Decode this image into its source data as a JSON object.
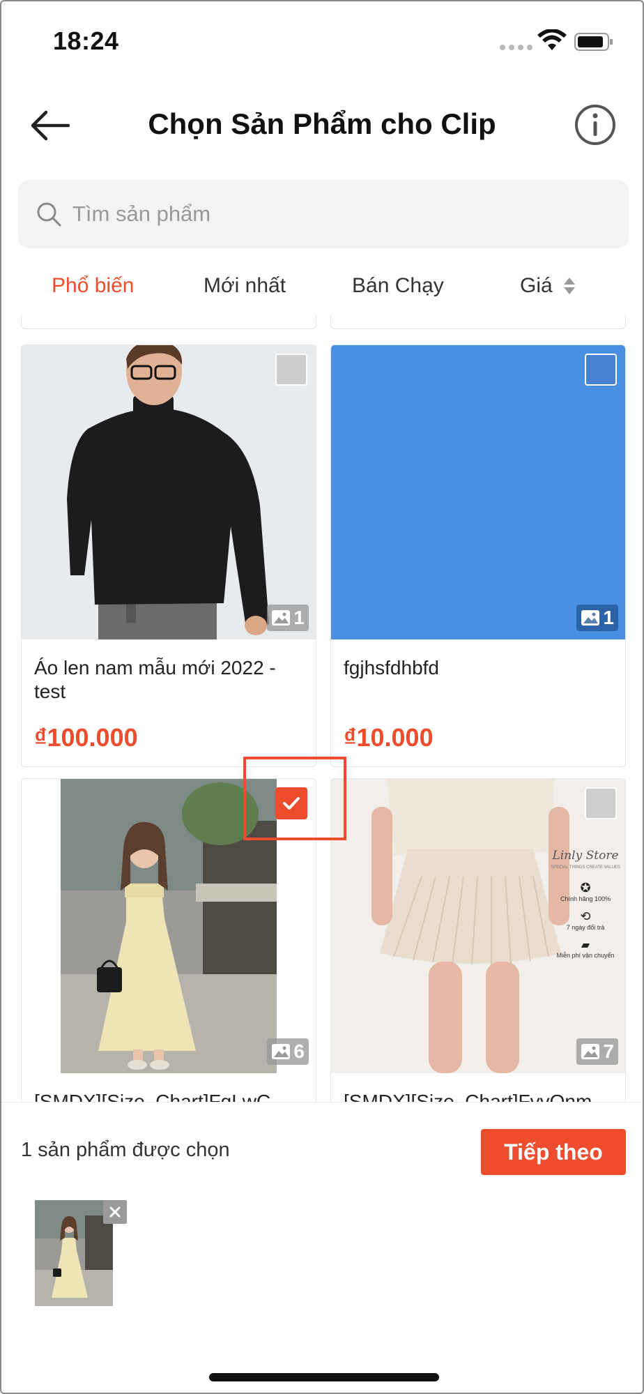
{
  "status_bar": {
    "time": "18:24"
  },
  "header": {
    "title": "Chọn Sản Phẩm cho Clip"
  },
  "search": {
    "placeholder": "Tìm sản phẩm"
  },
  "tabs": [
    {
      "label": "Phổ biến",
      "active": true
    },
    {
      "label": "Mới nhất",
      "active": false
    },
    {
      "label": "Bán Chạy",
      "active": false
    },
    {
      "label": "Giá",
      "active": false
    }
  ],
  "products": [
    {
      "name": "Áo len nam mẫu mới 2022 - test",
      "price": "₫100.000",
      "image_count": "1",
      "selected": false
    },
    {
      "name": "fgjhsfdhbfd",
      "price": "₫10.000",
      "image_count": "1",
      "selected": false
    },
    {
      "name": "[SMDX][Size_Chart]FqLwC",
      "price": "",
      "image_count": "6",
      "selected": true
    },
    {
      "name": "[SMDX][Size_Chart]FvvQnm",
      "price": "",
      "image_count": "7",
      "selected": false
    }
  ],
  "brand_overlay": {
    "store": "Linly Store",
    "tagline": "SPECIAL THINGS CREATE VALUES",
    "badge_1": "Chính hãng 100%",
    "badge_2": "7 ngày đổi trả",
    "badge_3": "Miễn phí vận chuyển"
  },
  "bottom_bar": {
    "selected_text": "1 sản phẩm được chọn",
    "next_label": "Tiếp theo"
  },
  "colors": {
    "accent": "#ee4d2d",
    "placeholder_blue": "#4a90e2"
  }
}
